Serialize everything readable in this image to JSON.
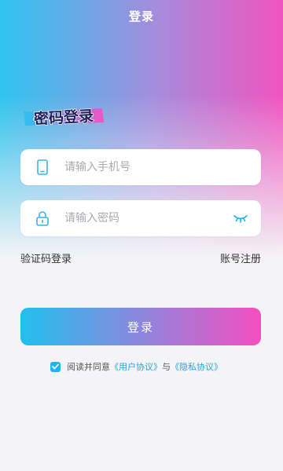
{
  "header": {
    "title": "登录"
  },
  "logo_title": "密码登录",
  "form": {
    "phone_placeholder": "请输入手机号",
    "password_placeholder": "请输入密码"
  },
  "links": {
    "sms_login": "验证码登录",
    "register": "账号注册"
  },
  "login_button": "登录",
  "agreement": {
    "checked": true,
    "prefix": "阅读并同意",
    "user_agreement": "《用户协议》",
    "conjunction": "与",
    "privacy_policy": "《隐私协议》"
  },
  "colors": {
    "gradient_start": "#2cc3ee",
    "gradient_end": "#f153bf",
    "accent": "#22a6dc",
    "background": "#f4f4f6"
  },
  "icons": [
    "phone-icon",
    "lock-icon",
    "eye-closed-icon",
    "checkbox-icon"
  ]
}
